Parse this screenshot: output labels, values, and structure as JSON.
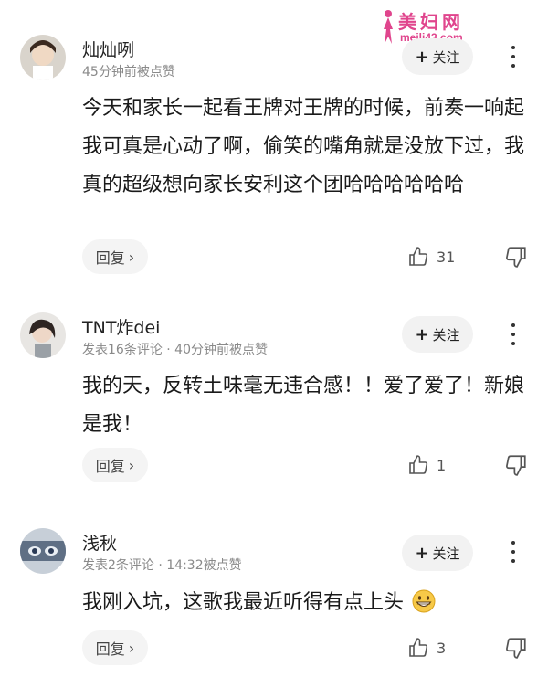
{
  "watermark": {
    "title": "美妇网",
    "url": "meili43.com"
  },
  "follow_label": "关注",
  "reply_label": "回复",
  "comments": [
    {
      "username": "灿灿咧",
      "meta": "45分钟前被点赞",
      "text": "今天和家长一起看王牌对王牌的时候，前奏一响起我可真是心动了啊，偷笑的嘴角就是没放下过，我真的超级想向家长安利这个团哈哈哈哈哈哈",
      "likes": "31"
    },
    {
      "username": "TNT炸dei",
      "meta": "发表16条评论 · 40分钟前被点赞",
      "text": "我的天，反转土味毫无违合感！！爱了爱了！新娘是我！",
      "likes": "1"
    },
    {
      "username": "浅秋",
      "meta": "发表2条评论 · 14:32被点赞",
      "text": "我刚入坑，这歌我最近听得有点上头",
      "likes": "3"
    }
  ]
}
